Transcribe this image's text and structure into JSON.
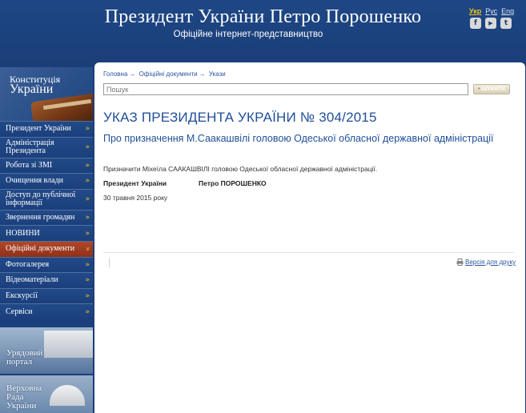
{
  "header": {
    "title": "Президент України Петро Порошенко",
    "subtitle": "Офіційне інтернет-представництво",
    "languages": [
      "Укр",
      "Рус",
      "Eng"
    ],
    "active_language": "Укр",
    "social": [
      {
        "icon": "facebook-icon",
        "glyph": "f"
      },
      {
        "icon": "youtube-icon",
        "glyph": "▶"
      },
      {
        "icon": "twitter-icon",
        "glyph": "t"
      }
    ]
  },
  "sidebar": {
    "constitution": {
      "line1": "Конституція",
      "line2": "України"
    },
    "menu": [
      {
        "label": "Президент України"
      },
      {
        "label": "Адміністрація Президента"
      },
      {
        "label": "Робота зі ЗМІ"
      },
      {
        "label": "Очищення влади"
      },
      {
        "label": "Доступ до публічної інформації"
      },
      {
        "label": "Звернення громадян"
      },
      {
        "label": "НОВИНИ"
      },
      {
        "label": "Офіційні документи"
      },
      {
        "label": "Фотогалерея"
      },
      {
        "label": "Відеоматеріали"
      },
      {
        "label": "Екскурсії"
      },
      {
        "label": "Сервіси"
      }
    ],
    "active_item": "Офіційні документи",
    "promos": [
      {
        "line1": "Урядовий",
        "line2": "портал"
      },
      {
        "line1": "Верховна",
        "line2": "Рада",
        "line3": "України"
      }
    ]
  },
  "breadcrumb": [
    "Головна",
    "Офіційні документи",
    "Укази"
  ],
  "breadcrumb_sep": "→",
  "search": {
    "placeholder": "Пошук",
    "button": "ШУКАТИ"
  },
  "decree": {
    "title": "УКАЗ ПРЕЗИДЕНТА УКРАЇНИ № 304/2015",
    "subtitle": "Про призначення М.Саакашвілі головою Одеської обласної державної адміністрації",
    "body": "Призначити Міхеїла СААКАШВІЛІ головою Одеської обласної державної адміністрації.",
    "signature_label": "Президент України",
    "signature_name": "Петро ПОРОШЕНКО",
    "date": "30 травня 2015 року"
  },
  "print_link": "Версія для друку",
  "colors": {
    "brand_blue": "#1b3f7c",
    "accent_gold": "#f0c419",
    "active_menu": "#a33d22",
    "link": "#2a56a1"
  }
}
